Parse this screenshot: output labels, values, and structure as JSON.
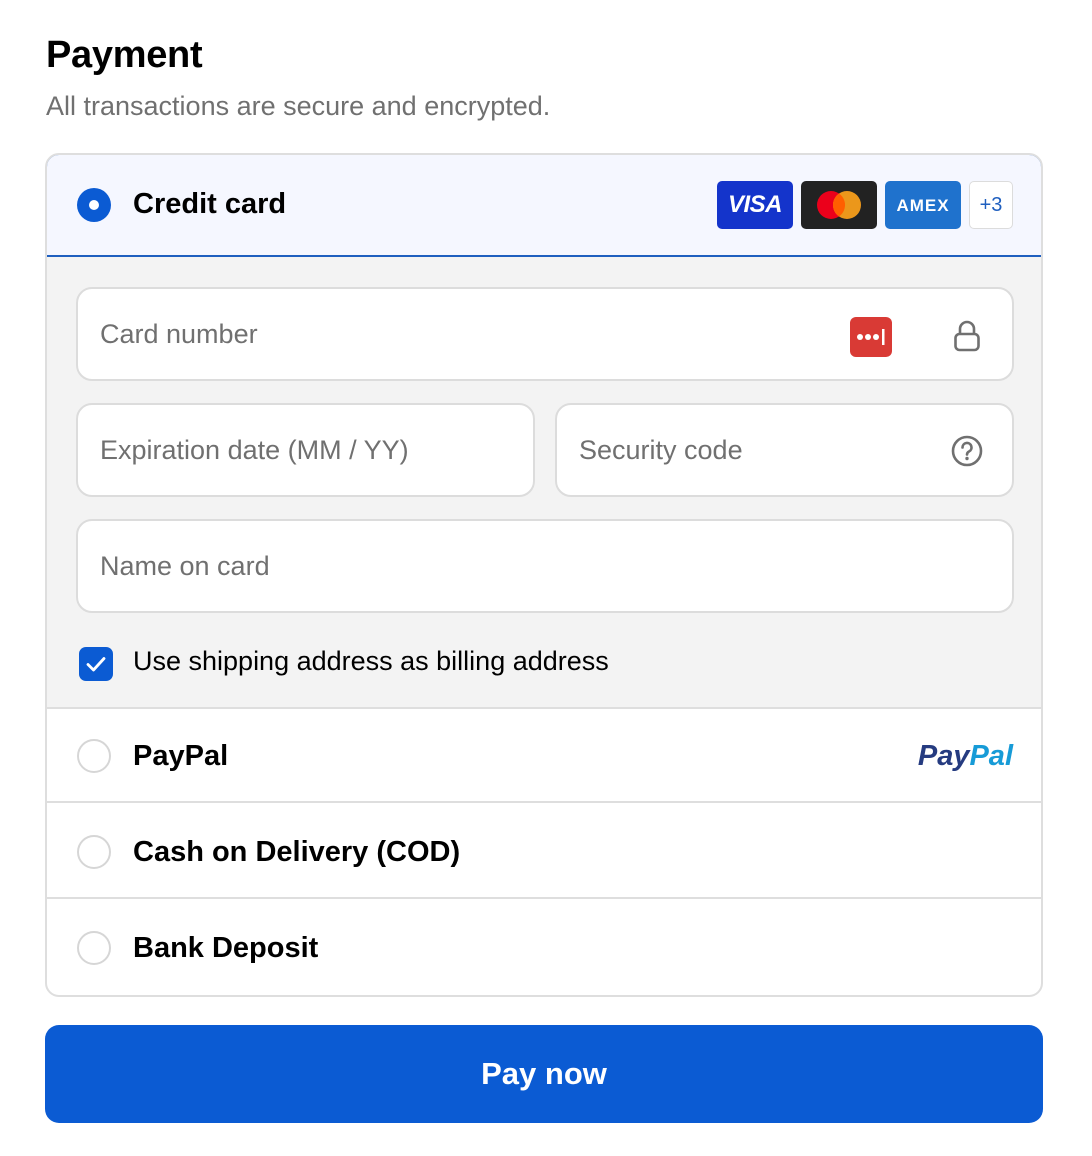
{
  "header": {
    "title": "Payment",
    "subtitle": "All transactions are secure and encrypted."
  },
  "payment_methods": {
    "credit_card": {
      "label": "Credit card",
      "selected": true,
      "card_brands": [
        "VISA",
        "mastercard",
        "AMEX"
      ],
      "more_brands": "+3",
      "card_number_placeholder": "Card number",
      "expiration_placeholder": "Expiration date (MM / YY)",
      "security_code_placeholder": "Security code",
      "name_placeholder": "Name on card",
      "billing_checkbox_label": "Use shipping address as billing address",
      "billing_checkbox_checked": true
    },
    "paypal": {
      "label": "PayPal",
      "logo_left": "Pay",
      "logo_right": "Pal",
      "selected": false
    },
    "cod": {
      "label": "Cash on Delivery (COD)",
      "selected": false
    },
    "bank": {
      "label": "Bank Deposit",
      "selected": false
    }
  },
  "pay_button": {
    "label": "Pay now"
  },
  "colors": {
    "accent": "#0b5bd3",
    "visa": "#1434cb",
    "amex": "#1f72cd",
    "paypal_dark": "#253b80",
    "paypal_light": "#179bd7",
    "password_manager": "#d93a35"
  },
  "icons": {
    "password_manager": "password-manager-icon",
    "lock": "lock-icon",
    "help": "help-circle-icon",
    "check": "checkmark-icon"
  }
}
